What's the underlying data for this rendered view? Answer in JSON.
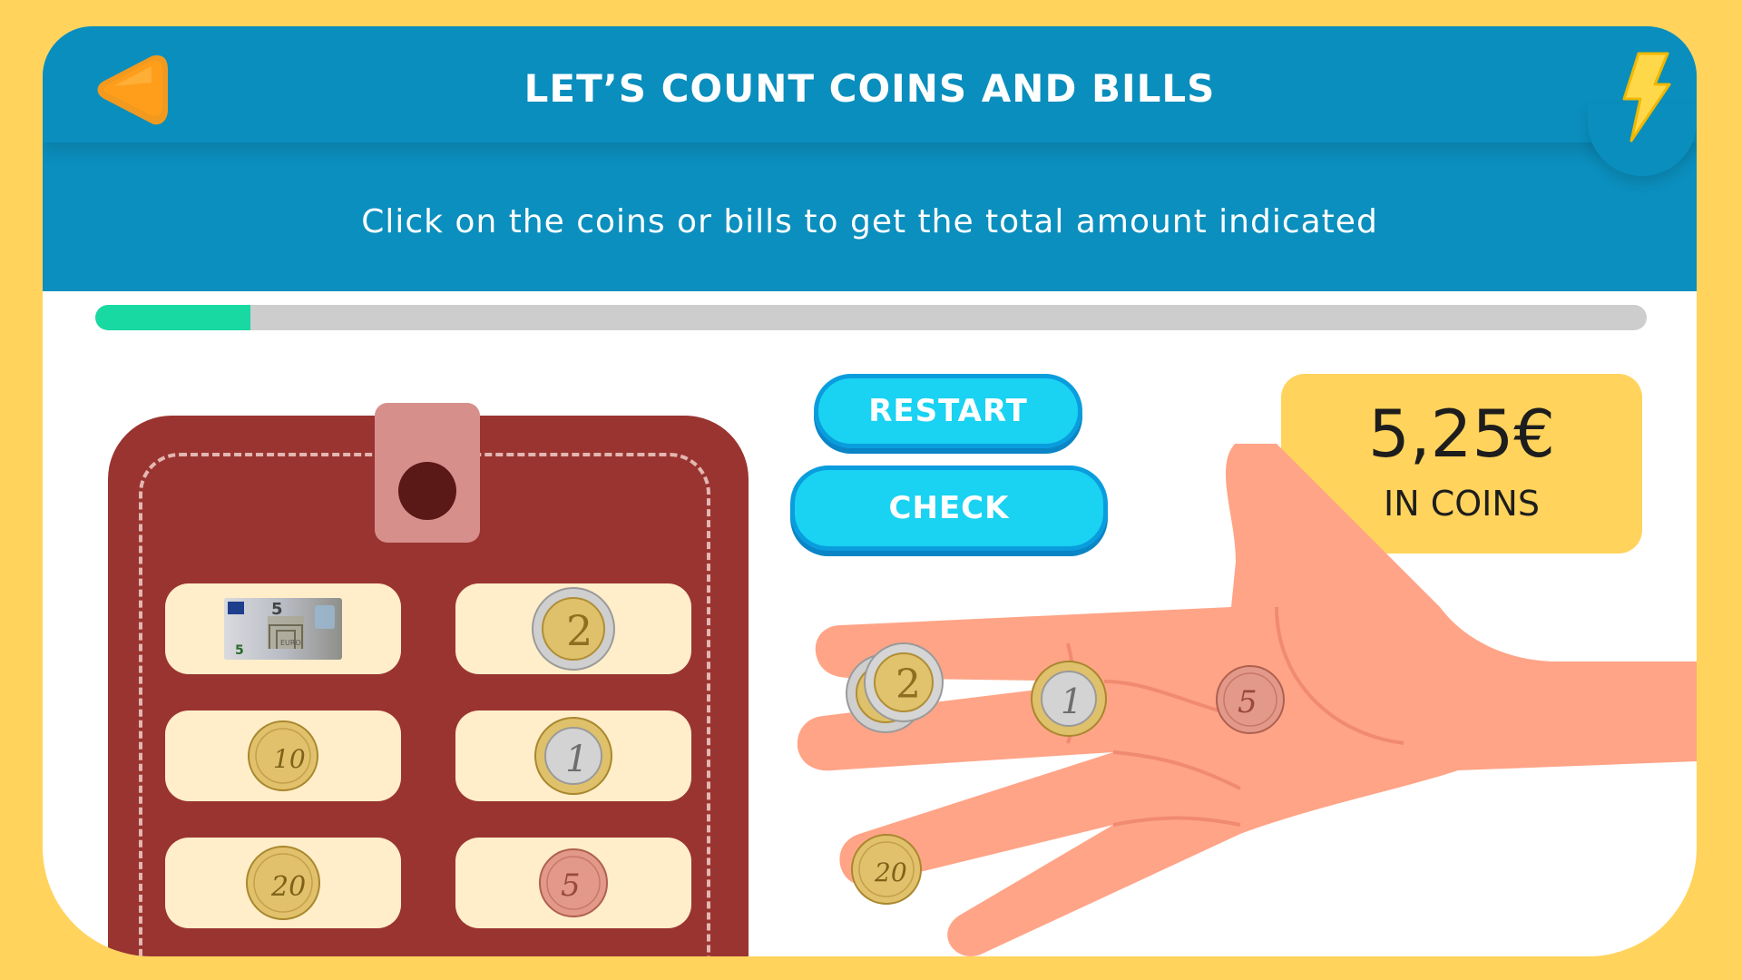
{
  "header": {
    "title": "LET’S COUNT COINS AND BILLS",
    "instruction": "Click on the coins or bills to get the total amount indicated"
  },
  "progress": {
    "fraction": 0.1
  },
  "buttons": {
    "restart": "RESTART",
    "check": "CHECK"
  },
  "target": {
    "amount": "5,25€",
    "label": "IN COINS"
  },
  "wallet": {
    "items": [
      {
        "kind": "bill",
        "denomination": "5",
        "bill_label": "EURO"
      },
      {
        "kind": "coin",
        "denomination": "2",
        "metal": "bimetal-gold-center"
      },
      {
        "kind": "coin",
        "denomination": "10",
        "metal": "gold"
      },
      {
        "kind": "coin",
        "denomination": "1",
        "metal": "bimetal-silver-center"
      },
      {
        "kind": "coin",
        "denomination": "20",
        "metal": "gold"
      },
      {
        "kind": "coin",
        "denomination": "5",
        "metal": "copper"
      }
    ]
  },
  "hand": {
    "coins": [
      {
        "denomination": "2",
        "metal": "bimetal-gold-center"
      },
      {
        "denomination": "2",
        "metal": "bimetal-gold-center"
      },
      {
        "denomination": "1",
        "metal": "bimetal-silver-center"
      },
      {
        "denomination": "5",
        "metal": "copper"
      },
      {
        "denomination": "20",
        "metal": "gold"
      }
    ]
  },
  "icons": {
    "back": "back-arrow-icon",
    "power": "lightning-bolt-icon"
  },
  "colors": {
    "background": "#FFD35C",
    "header": "#0B8FBE",
    "progress_fill": "#18D9A2",
    "button": "#1AD2F1",
    "wallet": "#9A3430",
    "hand": "#FFA487"
  }
}
